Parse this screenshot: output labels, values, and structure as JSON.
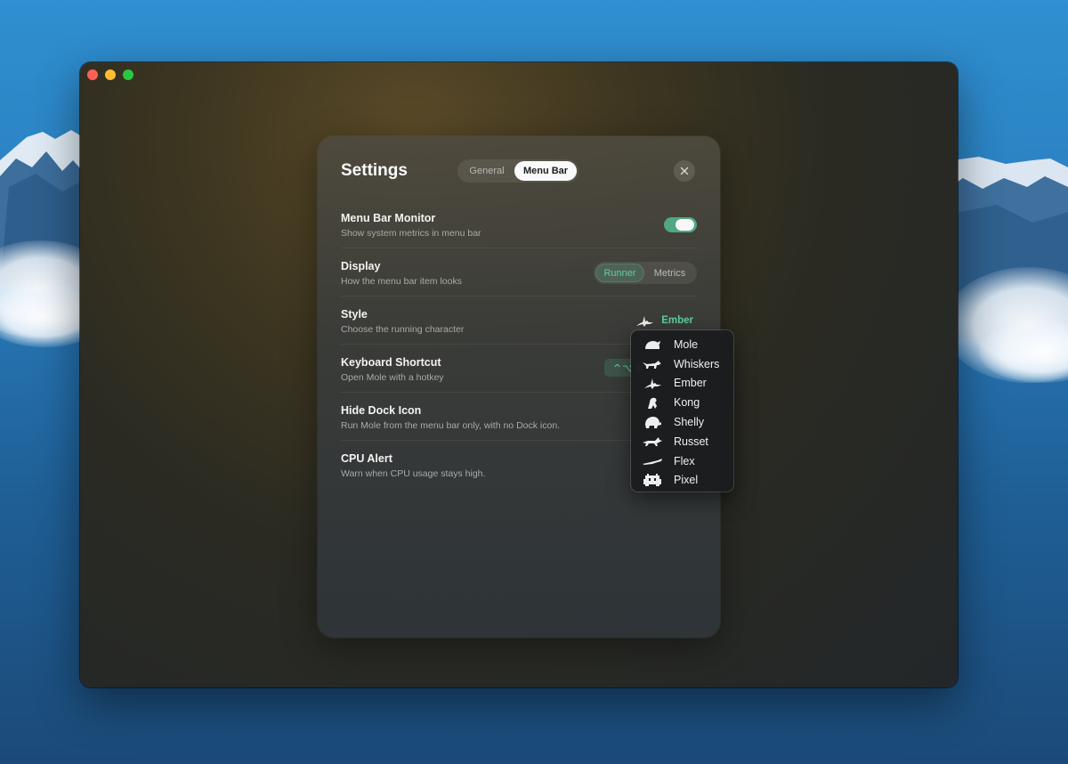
{
  "window": {
    "title": "Settings",
    "traffic_lights": {
      "close": "#ff5f57",
      "minimize": "#febc2e",
      "zoom": "#28c840"
    }
  },
  "tabs": [
    {
      "label": "General",
      "selected": false
    },
    {
      "label": "Menu Bar",
      "selected": true
    }
  ],
  "close_icon": "close-icon",
  "rows": {
    "menu_bar_monitor": {
      "title": "Menu Bar Monitor",
      "subtitle": "Show system metrics in menu bar",
      "toggle_on": true
    },
    "display": {
      "title": "Display",
      "subtitle": "How the menu bar item looks",
      "options": [
        "Runner",
        "Metrics"
      ],
      "selected": "Runner"
    },
    "style": {
      "title": "Style",
      "subtitle": "Choose the running character",
      "value": "Ember",
      "icon": "dragon-icon"
    },
    "keyboard_shortcut": {
      "title": "Keyboard Shortcut",
      "subtitle": "Open Mole with a hotkey",
      "value": "^⌥⌘"
    },
    "hide_dock_icon": {
      "title": "Hide Dock Icon",
      "subtitle": "Run Mole from the menu bar only, with no Dock icon."
    },
    "cpu_alert": {
      "title": "CPU Alert",
      "subtitle": "Warn when CPU usage stays high."
    }
  },
  "style_menu": {
    "items": [
      {
        "label": "Mole",
        "icon": "mole-icon"
      },
      {
        "label": "Whiskers",
        "icon": "cat-icon"
      },
      {
        "label": "Ember",
        "icon": "dragon-icon"
      },
      {
        "label": "Kong",
        "icon": "gorilla-icon"
      },
      {
        "label": "Shelly",
        "icon": "turtle-icon"
      },
      {
        "label": "Russet",
        "icon": "fox-icon"
      },
      {
        "label": "Flex",
        "icon": "gecko-icon"
      },
      {
        "label": "Pixel",
        "icon": "space-invader-icon"
      }
    ]
  },
  "colors": {
    "accent": "#5fcf9c",
    "toggle_on": "#4fa882",
    "panel_text": "#f3f3f3",
    "subtext": "#a9aaa8"
  }
}
